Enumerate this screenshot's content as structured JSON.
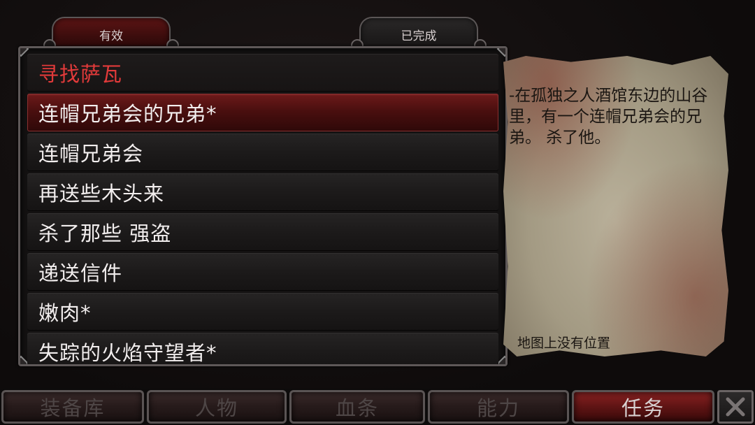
{
  "tabs": {
    "active_label": "有效",
    "completed_label": "已完成"
  },
  "quest_list": {
    "header": "寻找萨瓦",
    "items": [
      {
        "label": "连帽兄弟会的兄弟*",
        "selected": true
      },
      {
        "label": "连帽兄弟会",
        "selected": false
      },
      {
        "label": "再送些木头来",
        "selected": false
      },
      {
        "label": "杀了那些 强盗",
        "selected": false
      },
      {
        "label": "递送信件",
        "selected": false
      },
      {
        "label": "嫩肉*",
        "selected": false
      },
      {
        "label": "失踪的火焰守望者*",
        "selected": false
      }
    ]
  },
  "quest_detail": {
    "description": "-在孤独之人酒馆东边的山谷里，有一个连帽兄弟会的兄弟。 杀了他。",
    "map_note": "地图上没有位置"
  },
  "bottom_nav": {
    "items": [
      {
        "label": "装备库",
        "active": false
      },
      {
        "label": "人物",
        "active": false
      },
      {
        "label": "血条",
        "active": false
      },
      {
        "label": "能力",
        "active": false
      },
      {
        "label": "任务",
        "active": true
      }
    ],
    "close_icon": "close-x-icon"
  },
  "colors": {
    "accent_red": "#e23a3a",
    "selected_row": "#6e1a1a",
    "parchment": "#b9b09a"
  }
}
